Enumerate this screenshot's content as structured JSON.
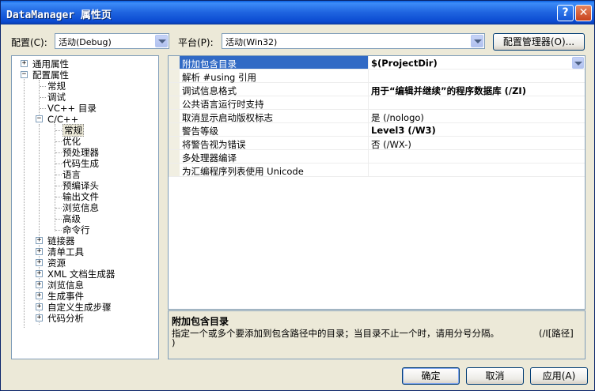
{
  "window": {
    "title": "DataManager 属性页",
    "help_glyph": "?",
    "close_glyph": "✕"
  },
  "config": {
    "label": "配置(C):",
    "value": "活动(Debug)"
  },
  "platform": {
    "label": "平台(P):",
    "value": "活动(Win32)"
  },
  "config_manager_label": "配置管理器(O)...",
  "tree": {
    "items": [
      {
        "label": "通用属性",
        "expander": "+"
      },
      {
        "label": "配置属性",
        "expander": "−"
      },
      {
        "label": "常规"
      },
      {
        "label": "调试"
      },
      {
        "label": "VC++ 目录"
      },
      {
        "label": "C/C++",
        "expander": "−"
      },
      {
        "label": "常规"
      },
      {
        "label": "优化"
      },
      {
        "label": "预处理器"
      },
      {
        "label": "代码生成"
      },
      {
        "label": "语言"
      },
      {
        "label": "预编译头"
      },
      {
        "label": "输出文件"
      },
      {
        "label": "浏览信息"
      },
      {
        "label": "高级"
      },
      {
        "label": "命令行"
      },
      {
        "label": "链接器",
        "expander": "+"
      },
      {
        "label": "清单工具",
        "expander": "+"
      },
      {
        "label": "资源",
        "expander": "+"
      },
      {
        "label": "XML 文档生成器",
        "expander": "+"
      },
      {
        "label": "浏览信息",
        "expander": "+"
      },
      {
        "label": "生成事件",
        "expander": "+"
      },
      {
        "label": "自定义生成步骤",
        "expander": "+"
      },
      {
        "label": "代码分析",
        "expander": "+"
      }
    ]
  },
  "properties": {
    "rows": [
      {
        "name": "附加包含目录",
        "value": "$(ProjectDir)"
      },
      {
        "name": "解析 #using 引用",
        "value": ""
      },
      {
        "name": "调试信息格式",
        "value": "用于“编辑并继续”的程序数据库 (/ZI)"
      },
      {
        "name": "公共语言运行时支持",
        "value": ""
      },
      {
        "name": "取消显示启动版权标志",
        "value": "是 (/nologo)"
      },
      {
        "name": "警告等级",
        "value": "Level3 (/W3)"
      },
      {
        "name": "将警告视为错误",
        "value": "否 (/WX-)"
      },
      {
        "name": "多处理器编译",
        "value": ""
      },
      {
        "name": "为汇编程序列表使用 Unicode",
        "value": ""
      }
    ]
  },
  "description": {
    "title": "附加包含目录",
    "text_line1": "指定一个或多个要添加到包含路径中的目录；当目录不止一个时，请用分号分隔。",
    "text_suffix": "(/I[路径]",
    "text_line2": ")"
  },
  "buttons": {
    "ok": "确定",
    "cancel": "取消",
    "apply": "应用(A)"
  }
}
